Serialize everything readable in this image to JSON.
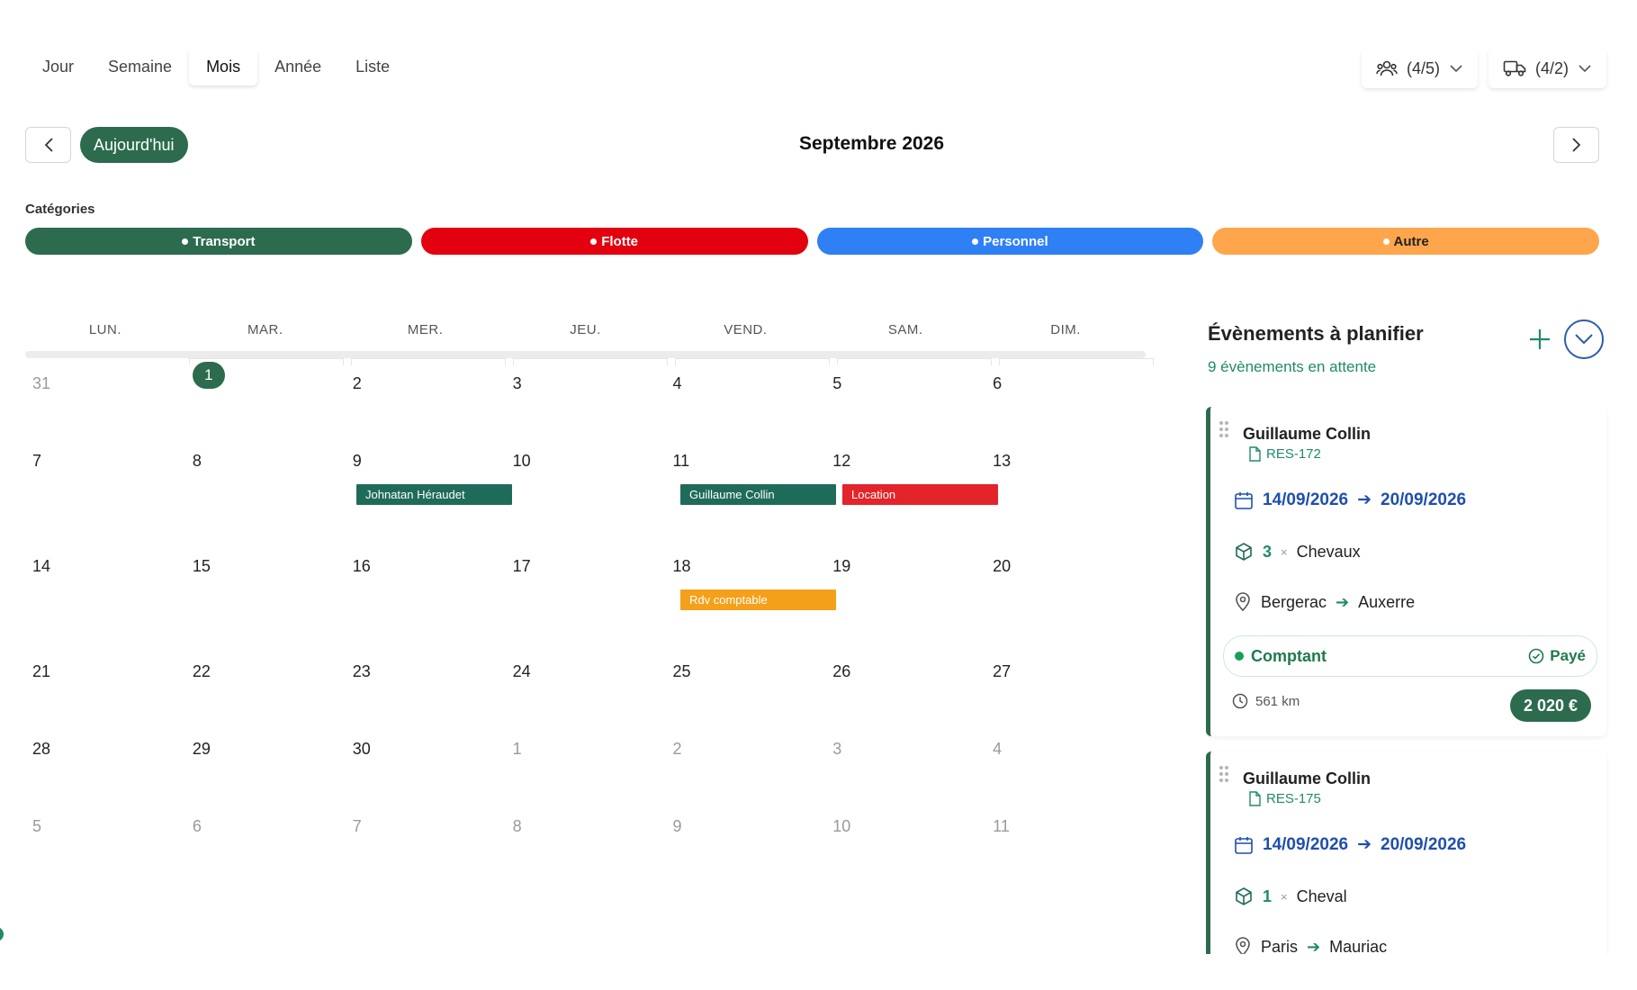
{
  "view_tabs": [
    {
      "label": "Jour",
      "active": false
    },
    {
      "label": "Semaine",
      "active": false
    },
    {
      "label": "Mois",
      "active": true
    },
    {
      "label": "Année",
      "active": false
    },
    {
      "label": "Liste",
      "active": false
    }
  ],
  "filters": {
    "staff": {
      "label": "(4/5)",
      "icon": "users-icon"
    },
    "vehicles": {
      "label": "(4/2)",
      "icon": "truck-icon"
    }
  },
  "nav": {
    "today_label": "Aujourd'hui",
    "month_title": "Septembre 2026"
  },
  "categories": {
    "label": "Catégories",
    "items": [
      {
        "label": "Transport",
        "color": "#2c6b4e"
      },
      {
        "label": "Flotte",
        "color": "#e3000f"
      },
      {
        "label": "Personnel",
        "color": "#2f7ff5"
      },
      {
        "label": "Autre",
        "color": "#ffa64d"
      }
    ]
  },
  "calendar": {
    "weekdays": [
      "LUN.",
      "MAR.",
      "MER.",
      "JEU.",
      "VEND.",
      "SAM.",
      "DIM."
    ],
    "weeks": [
      [
        {
          "d": "31",
          "m": true
        },
        {
          "d": "1",
          "today": true
        },
        {
          "d": "2"
        },
        {
          "d": "3"
        },
        {
          "d": "4"
        },
        {
          "d": "5"
        },
        {
          "d": "6"
        }
      ],
      [
        {
          "d": "7"
        },
        {
          "d": "8"
        },
        {
          "d": "9"
        },
        {
          "d": "10"
        },
        {
          "d": "11"
        },
        {
          "d": "12"
        },
        {
          "d": "13"
        }
      ],
      [
        {
          "d": "14"
        },
        {
          "d": "15"
        },
        {
          "d": "16"
        },
        {
          "d": "17"
        },
        {
          "d": "18"
        },
        {
          "d": "19"
        },
        {
          "d": "20"
        }
      ],
      [
        {
          "d": "21"
        },
        {
          "d": "22"
        },
        {
          "d": "23"
        },
        {
          "d": "24"
        },
        {
          "d": "25"
        },
        {
          "d": "26"
        },
        {
          "d": "27"
        }
      ],
      [
        {
          "d": "28"
        },
        {
          "d": "29"
        },
        {
          "d": "30"
        },
        {
          "d": "1",
          "m": true
        },
        {
          "d": "2",
          "m": true
        },
        {
          "d": "3",
          "m": true
        },
        {
          "d": "4",
          "m": true
        }
      ],
      [
        {
          "d": "5",
          "m": true
        },
        {
          "d": "6",
          "m": true
        },
        {
          "d": "7",
          "m": true
        },
        {
          "d": "8",
          "m": true
        },
        {
          "d": "9",
          "m": true
        },
        {
          "d": "10",
          "m": true
        },
        {
          "d": "11",
          "m": true
        }
      ]
    ],
    "events": [
      {
        "label": "Johnatan Héraudet",
        "week": 1,
        "day": 2,
        "color": "#1f6b5a"
      },
      {
        "label": "Guillaume Collin",
        "week": 1,
        "day": 4,
        "color": "#1f6b5a"
      },
      {
        "label": "Location",
        "week": 1,
        "day": 5,
        "color": "#e3242b"
      },
      {
        "label": "Rdv comptable",
        "week": 2,
        "day": 4,
        "color": "#f5a01a"
      }
    ]
  },
  "side_panel": {
    "title": "Évènements à planifier",
    "subtitle": "9 évènements en attente",
    "cards": [
      {
        "name": "Guillaume Collin",
        "ref": "RES-172",
        "date_from": "14/09/2026",
        "date_to": "20/09/2026",
        "qty": "3",
        "qty_sep": "×",
        "item": "Chevaux",
        "from": "Bergerac",
        "to": "Auxerre",
        "payment": "Comptant",
        "status": "Payé",
        "distance": "561 km",
        "price": "2 020 €"
      },
      {
        "name": "Guillaume Collin",
        "ref": "RES-175",
        "date_from": "14/09/2026",
        "date_to": "20/09/2026",
        "qty": "1",
        "qty_sep": "×",
        "item": "Cheval",
        "from": "Paris",
        "to": "Mauriac"
      }
    ]
  }
}
